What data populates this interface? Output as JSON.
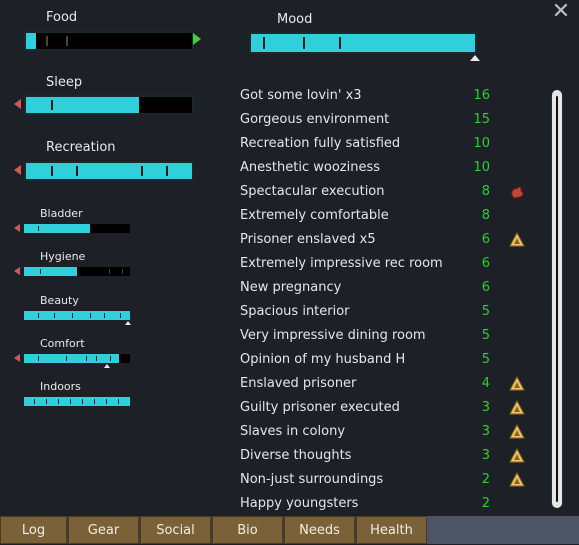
{
  "needs": [
    {
      "label": "Food",
      "level": 0.06
    },
    {
      "label": "Sleep",
      "level": 0.68
    },
    {
      "label": "Recreation",
      "level": 1.0
    },
    {
      "label": "Bladder",
      "level": 0.62
    },
    {
      "label": "Hygiene",
      "level": 0.5
    },
    {
      "label": "Beauty",
      "level": 1.0
    },
    {
      "label": "Comfort",
      "level": 0.9
    },
    {
      "label": "Indoors",
      "level": 1.0
    }
  ],
  "mood": {
    "label": "Mood",
    "level": 1.0
  },
  "thoughts": [
    {
      "label": "Got some lovin' x3",
      "value": "16",
      "icon": ""
    },
    {
      "label": "Gorgeous environment",
      "value": "15",
      "icon": ""
    },
    {
      "label": "Recreation fully satisfied",
      "value": "10",
      "icon": ""
    },
    {
      "label": "Anesthetic wooziness",
      "value": "10",
      "icon": ""
    },
    {
      "label": "Spectacular execution",
      "value": "8",
      "icon": "hand-icon"
    },
    {
      "label": "Extremely comfortable",
      "value": "8",
      "icon": ""
    },
    {
      "label": "Prisoner enslaved x5",
      "value": "6",
      "icon": "ideology-icon"
    },
    {
      "label": "Extremely impressive rec room",
      "value": "6",
      "icon": ""
    },
    {
      "label": "New pregnancy",
      "value": "6",
      "icon": ""
    },
    {
      "label": "Spacious interior",
      "value": "5",
      "icon": ""
    },
    {
      "label": "Very impressive dining room",
      "value": "5",
      "icon": ""
    },
    {
      "label": "Opinion of my husband H",
      "value": "5",
      "icon": ""
    },
    {
      "label": "Enslaved prisoner",
      "value": "4",
      "icon": "ideology-icon"
    },
    {
      "label": "Guilty prisoner executed",
      "value": "3",
      "icon": "ideology-icon"
    },
    {
      "label": "Slaves in colony",
      "value": "3",
      "icon": "ideology-icon"
    },
    {
      "label": "Diverse thoughts",
      "value": "3",
      "icon": "ideology-icon"
    },
    {
      "label": "Non-just surroundings",
      "value": "2",
      "icon": "ideology-icon"
    },
    {
      "label": "Happy youngsters",
      "value": "2",
      "icon": ""
    }
  ],
  "tabs": [
    {
      "label": "Log"
    },
    {
      "label": "Gear"
    },
    {
      "label": "Social"
    },
    {
      "label": "Bio"
    },
    {
      "label": "Needs"
    },
    {
      "label": "Health"
    }
  ],
  "close_icon": "close-icon",
  "colors": {
    "bar_fill": "#2fd0dc",
    "positive": "#2bd02b",
    "arrow_down": "#d05858",
    "arrow_up": "#3fcf3f",
    "tab": "#7a6138"
  }
}
